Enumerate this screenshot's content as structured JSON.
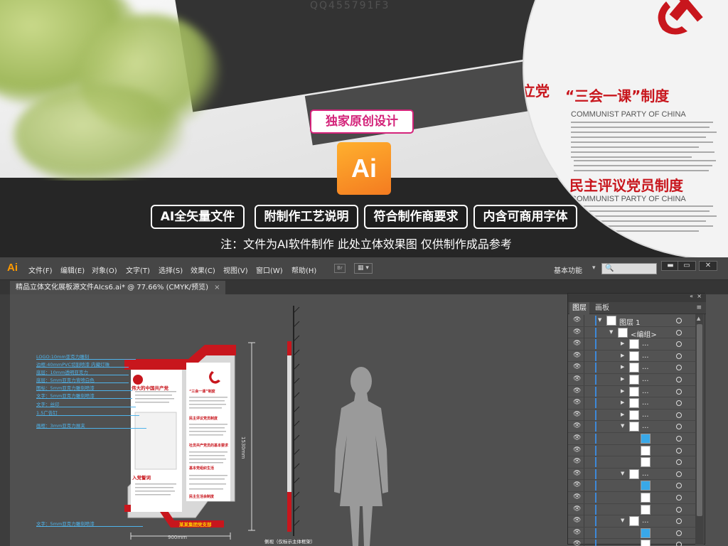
{
  "promo": {
    "badge": "独家原创设计",
    "ai_icon_text": "Ai",
    "features": [
      "AI全矢量文件",
      "附制作工艺说明",
      "符合制作商要求",
      "内含可商用字体"
    ],
    "note": "注：文件为AI软件制作 此处立体效果图 仅供制作成品参考",
    "watermark": "QQ455791F3",
    "circle": {
      "title1": "立党",
      "title2": "“三会一课”制度",
      "sub1": "COMMUNIST PARTY OF CHINA",
      "title3": "民主评议党员制度",
      "sub2": "COMMUNIST PARTY OF CHINA"
    }
  },
  "app": {
    "logo": "Ai",
    "menu": [
      "文件(F)",
      "编辑(E)",
      "对象(O)",
      "文字(T)",
      "选择(S)",
      "效果(C)",
      "视图(V)",
      "窗口(W)",
      "帮助(H)"
    ],
    "br": "Br",
    "arrange": "▦ ▾",
    "workspace": "基本功能",
    "workspace_caret": "▾",
    "search_icon": "search-icon",
    "search_glyph": "🔍",
    "window_buttons": [
      "▬",
      "▭",
      "✕"
    ],
    "doc_tab": "精品立体文化展板源文件AIcs6.ai* @ 77.66% (CMYK/预览)",
    "doc_tab_close": "×"
  },
  "drawing": {
    "callouts": [
      "LOGO:10mm亚克力雕刻",
      "边框:40mmPVC切割喷漆 内藏灯珠",
      "底层：10mm透明亚克力",
      "底层：5mm亚克力背喷白色",
      "图标：5mm亚克力雕刻喷漆",
      "文字：5mm亚克力雕刻喷漆",
      "文字：丝印",
      "1.5广告钉",
      "画框：3mm亚克力展夹",
      "文字：5mm亚克力雕刻喷漆"
    ],
    "board_title": "伟大的中国共产党",
    "board_section1": "“三会一课”制度",
    "board_section2": "民主评议党员制度",
    "board_section3": "社员共产党员的基本要求",
    "board_section4": "基本党组织生活",
    "board_section5": "民主生活会制度",
    "board_join": "入党誓词",
    "board_footer": "某某集团党支部",
    "dim_height": "1530mm",
    "dim_width": "900mm",
    "side_view": "侧视（仅标示主体框架）"
  },
  "layers": {
    "top_collapse": "«",
    "top_close": "×",
    "tab_layers": "图层",
    "tab_artboards": "画板",
    "panel_menu": "≡",
    "rows": [
      {
        "name": "图层 1",
        "indent": 0,
        "expanded": true,
        "thumb": "white"
      },
      {
        "name": "<编组>",
        "indent": 1,
        "expanded": true,
        "thumb": "white"
      },
      {
        "name": "...",
        "indent": 2,
        "expanded": false,
        "thumb": "white"
      },
      {
        "name": "...",
        "indent": 2,
        "expanded": false,
        "thumb": "white"
      },
      {
        "name": "...",
        "indent": 2,
        "expanded": false,
        "thumb": "white"
      },
      {
        "name": "...",
        "indent": 2,
        "expanded": false,
        "thumb": "white"
      },
      {
        "name": "...",
        "indent": 2,
        "expanded": false,
        "thumb": "white"
      },
      {
        "name": "...",
        "indent": 2,
        "expanded": false,
        "thumb": "white"
      },
      {
        "name": "...",
        "indent": 2,
        "expanded": false,
        "thumb": "white"
      },
      {
        "name": "...",
        "indent": 2,
        "expanded": true,
        "thumb": "white"
      },
      {
        "name": "",
        "indent": 3,
        "expanded": null,
        "thumb": "blue"
      },
      {
        "name": "",
        "indent": 3,
        "expanded": null,
        "thumb": "white"
      },
      {
        "name": "",
        "indent": 3,
        "expanded": null,
        "thumb": "white"
      },
      {
        "name": "...",
        "indent": 2,
        "expanded": true,
        "thumb": "white"
      },
      {
        "name": "",
        "indent": 3,
        "expanded": null,
        "thumb": "blue"
      },
      {
        "name": "",
        "indent": 3,
        "expanded": null,
        "thumb": "white"
      },
      {
        "name": "",
        "indent": 3,
        "expanded": null,
        "thumb": "white"
      },
      {
        "name": "...",
        "indent": 2,
        "expanded": true,
        "thumb": "white"
      },
      {
        "name": "",
        "indent": 3,
        "expanded": null,
        "thumb": "blue"
      },
      {
        "name": "",
        "indent": 3,
        "expanded": null,
        "thumb": "white"
      }
    ]
  },
  "colors": {
    "accent_red": "#c8161d",
    "badge_pink": "#d4237a",
    "ai_orange": "#f7931e",
    "callout_blue": "#4fb3ea",
    "selection_blue": "#3e88d8"
  }
}
